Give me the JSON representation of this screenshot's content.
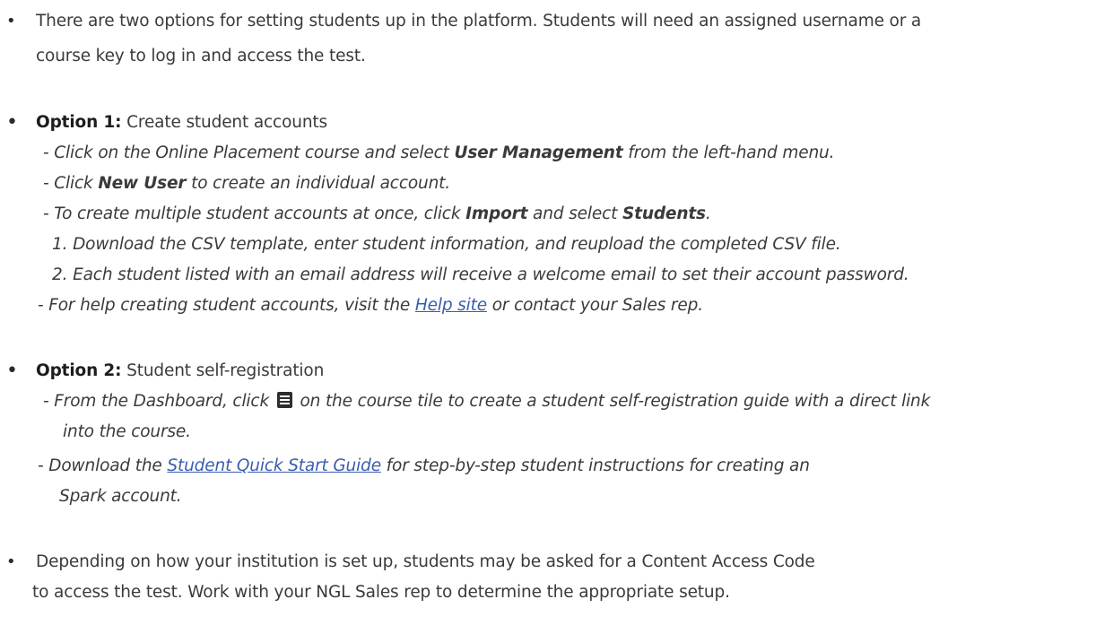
{
  "intro": {
    "line1": "There are two options for setting students up in the platform. Students will need an assigned username or a",
    "line2": "course key to log in and access the test."
  },
  "option1": {
    "heading_bold": "Option 1:",
    "heading_rest": " Create student accounts",
    "step1_a": "- Click on the Online Placement course and select ",
    "step1_b": "User Management",
    "step1_c": " from the left-hand menu.",
    "step2_a": "- Click ",
    "step2_b": "New User",
    "step2_c": " to create an individual account.",
    "step3_a": "- To create multiple student accounts at once, click ",
    "step3_b": "Import",
    "step3_c": " and select ",
    "step3_d": "Students",
    "step3_e": ".",
    "sub1": "1. Download the CSV template, enter student information, and reupload the completed CSV file.",
    "sub2": "2. Each student listed with an email address will receive a welcome email to set their account password.",
    "help_a": "- For help creating student accounts, visit the ",
    "help_link": "Help site",
    "help_b": " or contact your Sales rep."
  },
  "option2": {
    "heading_bold": "Option 2:",
    "heading_rest": " Student self-registration",
    "step1_a": "- From the Dashboard, click ",
    "step1_icon": "document-icon",
    "step1_b": " on the course tile to create a student self-registration guide with a direct link",
    "step1_c": "into the course.",
    "step2_a": "- Download the ",
    "step2_link": "Student Quick Start Guide",
    "step2_b": " for step-by-step student instructions for creating an",
    "step2_c": "Spark account."
  },
  "note": {
    "line1": "Depending on how your institution is set up, students may be asked for a Content Access Code",
    "line2": "to access the test. Work with your NGL Sales rep to determine the appropriate setup."
  },
  "colors": {
    "text": "#3a3a3a",
    "link": "#3a5dae"
  }
}
